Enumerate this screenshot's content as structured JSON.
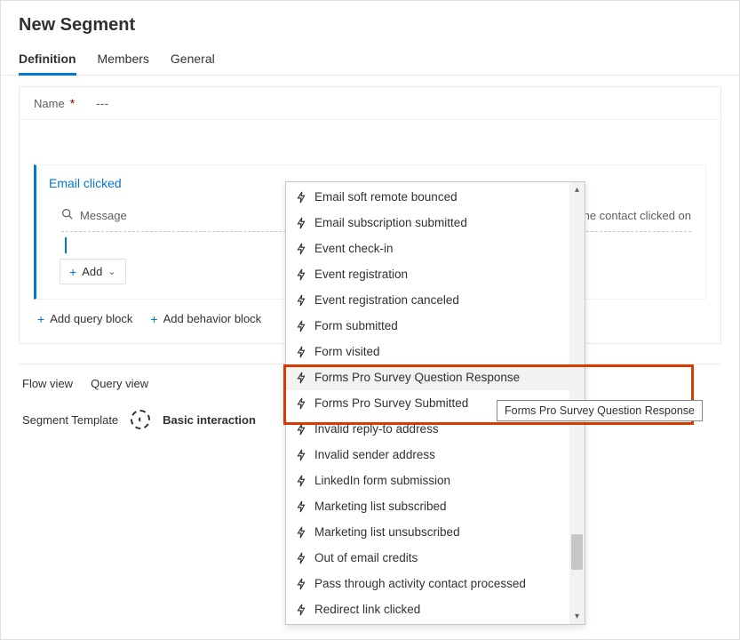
{
  "page_title": "New Segment",
  "tabs": [
    {
      "label": "Definition",
      "active": true
    },
    {
      "label": "Members",
      "active": false
    },
    {
      "label": "General",
      "active": false
    }
  ],
  "name_row": {
    "label": "Name",
    "value": "---"
  },
  "query_block": {
    "header": "Email clicked",
    "message_label": "Message",
    "hint_suffix": "ail that the contact clicked on",
    "add_label": "Add"
  },
  "link_row": {
    "add_query_block": "Add query block",
    "add_behavior_block": "Add behavior block"
  },
  "bottom": {
    "flow_view": "Flow view",
    "query_view": "Query view",
    "segment_template": "Segment Template",
    "template_value": "Basic interaction"
  },
  "dropdown_items": [
    "Email soft remote bounced",
    "Email subscription submitted",
    "Event check-in",
    "Event registration",
    "Event registration canceled",
    "Form submitted",
    "Form visited",
    "Forms Pro Survey Question Response",
    "Forms Pro Survey Submitted",
    "Invalid reply-to address",
    "Invalid sender address",
    "LinkedIn form submission",
    "Marketing list subscribed",
    "Marketing list unsubscribed",
    "Out of email credits",
    "Pass through activity contact processed",
    "Redirect link clicked"
  ],
  "dropdown_hover_index": 7,
  "tooltip_text": "Forms Pro Survey Question Response"
}
